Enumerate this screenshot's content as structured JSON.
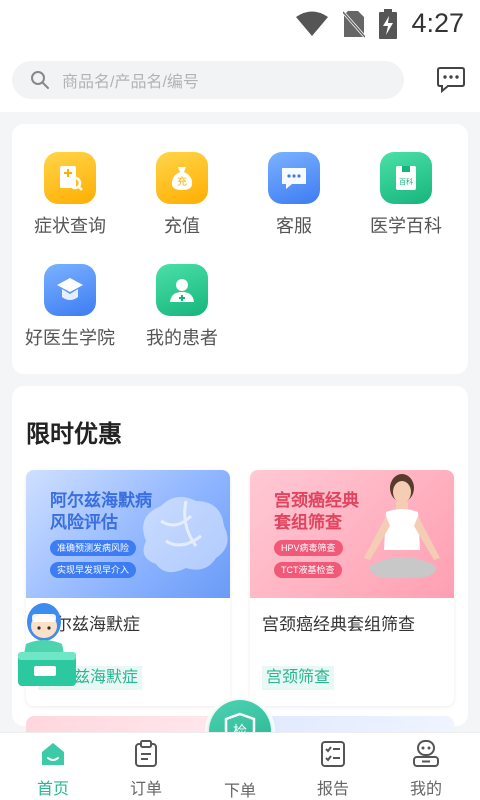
{
  "status_bar": {
    "time": "4:27"
  },
  "search": {
    "placeholder": "商品名/产品名/编号"
  },
  "menu": [
    {
      "label": "症状查询",
      "icon": "symptom-search-icon",
      "color": "#ffb400"
    },
    {
      "label": "充值",
      "icon": "moneybag-icon",
      "color": "#ffb400"
    },
    {
      "label": "客服",
      "icon": "chat-bubble-icon",
      "color": "#4a8cf7"
    },
    {
      "label": "医学百科",
      "icon": "encyclopedia-icon",
      "color": "#22c38e"
    },
    {
      "label": "好医生学院",
      "icon": "academy-cap-icon",
      "color": "#4a8cf7"
    },
    {
      "label": "我的患者",
      "icon": "patient-icon",
      "color": "#22c38e"
    }
  ],
  "promo": {
    "title": "限时优惠",
    "products": [
      {
        "name": "阿尔兹海默症",
        "tag": "阿尔兹海默症",
        "image_title": "阿尔兹海默病\n风险评估",
        "image_pills": [
          "准确预测发病风险",
          "实现早发现早介入"
        ]
      },
      {
        "name": "宫颈癌经典套组筛查",
        "tag": "宫颈筛查",
        "image_title": "宫颈癌经典\n套组筛查",
        "image_pills": [
          "HPV病毒筛查",
          "TCT液基检查"
        ]
      }
    ]
  },
  "fab": {
    "label": "检"
  },
  "tabs": [
    {
      "label": "首页",
      "icon": "home-icon",
      "active": true
    },
    {
      "label": "订单",
      "icon": "clipboard-icon",
      "active": false
    },
    {
      "label": "下单",
      "icon": "shield-check-icon",
      "active": false
    },
    {
      "label": "报告",
      "icon": "report-icon",
      "active": false
    },
    {
      "label": "我的",
      "icon": "profile-icon",
      "active": false
    }
  ],
  "colors": {
    "accent": "#2bb592",
    "tag_bg": "#e8f8f4"
  }
}
